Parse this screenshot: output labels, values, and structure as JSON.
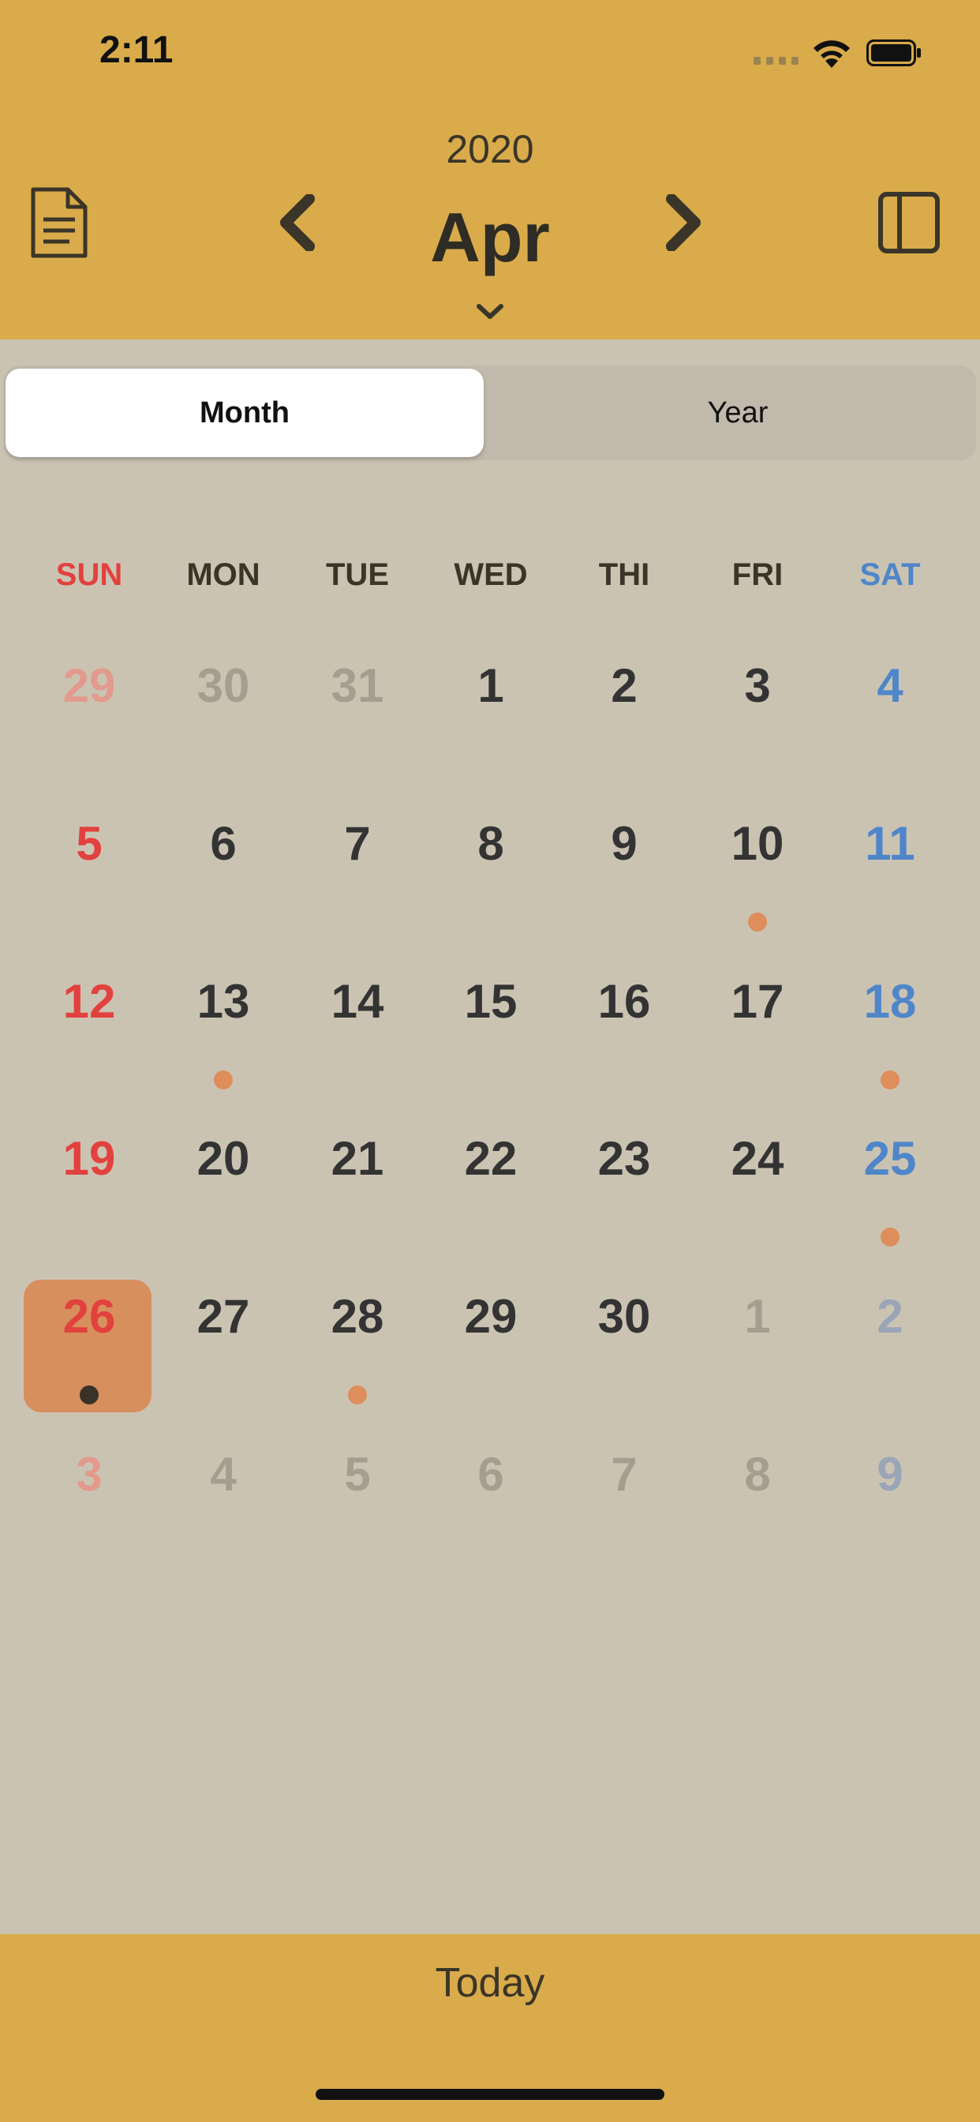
{
  "status_bar": {
    "time": "2:11"
  },
  "header": {
    "year": "2020",
    "month": "Apr"
  },
  "segmented": {
    "month_label": "Month",
    "year_label": "Year",
    "selected": "Month"
  },
  "weekdays": [
    "SUN",
    "MON",
    "TUE",
    "WED",
    "THI",
    "FRI",
    "SAT"
  ],
  "calendar": {
    "rows": [
      [
        {
          "d": "29",
          "cur": false
        },
        {
          "d": "30",
          "cur": false
        },
        {
          "d": "31",
          "cur": false
        },
        {
          "d": "1",
          "cur": true
        },
        {
          "d": "2",
          "cur": true
        },
        {
          "d": "3",
          "cur": true
        },
        {
          "d": "4",
          "cur": true
        }
      ],
      [
        {
          "d": "5",
          "cur": true
        },
        {
          "d": "6",
          "cur": true
        },
        {
          "d": "7",
          "cur": true
        },
        {
          "d": "8",
          "cur": true
        },
        {
          "d": "9",
          "cur": true
        },
        {
          "d": "10",
          "cur": true,
          "event": true
        },
        {
          "d": "11",
          "cur": true
        }
      ],
      [
        {
          "d": "12",
          "cur": true
        },
        {
          "d": "13",
          "cur": true,
          "event": true
        },
        {
          "d": "14",
          "cur": true
        },
        {
          "d": "15",
          "cur": true
        },
        {
          "d": "16",
          "cur": true
        },
        {
          "d": "17",
          "cur": true
        },
        {
          "d": "18",
          "cur": true,
          "event": true
        }
      ],
      [
        {
          "d": "19",
          "cur": true
        },
        {
          "d": "20",
          "cur": true
        },
        {
          "d": "21",
          "cur": true
        },
        {
          "d": "22",
          "cur": true
        },
        {
          "d": "23",
          "cur": true
        },
        {
          "d": "24",
          "cur": true
        },
        {
          "d": "25",
          "cur": true,
          "event": true
        }
      ],
      [
        {
          "d": "26",
          "cur": true,
          "event": true,
          "today": true
        },
        {
          "d": "27",
          "cur": true
        },
        {
          "d": "28",
          "cur": true,
          "event": true
        },
        {
          "d": "29",
          "cur": true
        },
        {
          "d": "30",
          "cur": true
        },
        {
          "d": "1",
          "cur": false
        },
        {
          "d": "2",
          "cur": false
        }
      ],
      [
        {
          "d": "3",
          "cur": false
        },
        {
          "d": "4",
          "cur": false
        },
        {
          "d": "5",
          "cur": false
        },
        {
          "d": "6",
          "cur": false
        },
        {
          "d": "7",
          "cur": false
        },
        {
          "d": "8",
          "cur": false
        },
        {
          "d": "9",
          "cur": false
        }
      ]
    ]
  },
  "footer": {
    "today_label": "Today"
  },
  "colors": {
    "header_bg": "#d9ab4a",
    "body_bg": "#cbc3b2",
    "sunday": "#e2413e",
    "saturday": "#4f86c9",
    "event_dot": "#dd8e5b",
    "today_highlight": "#d78f5e"
  },
  "icons": {
    "left": "document-icon",
    "prev": "chevron-left-icon",
    "next": "chevron-right-icon",
    "picker": "chevron-down-icon",
    "right": "sidebar-icon"
  }
}
